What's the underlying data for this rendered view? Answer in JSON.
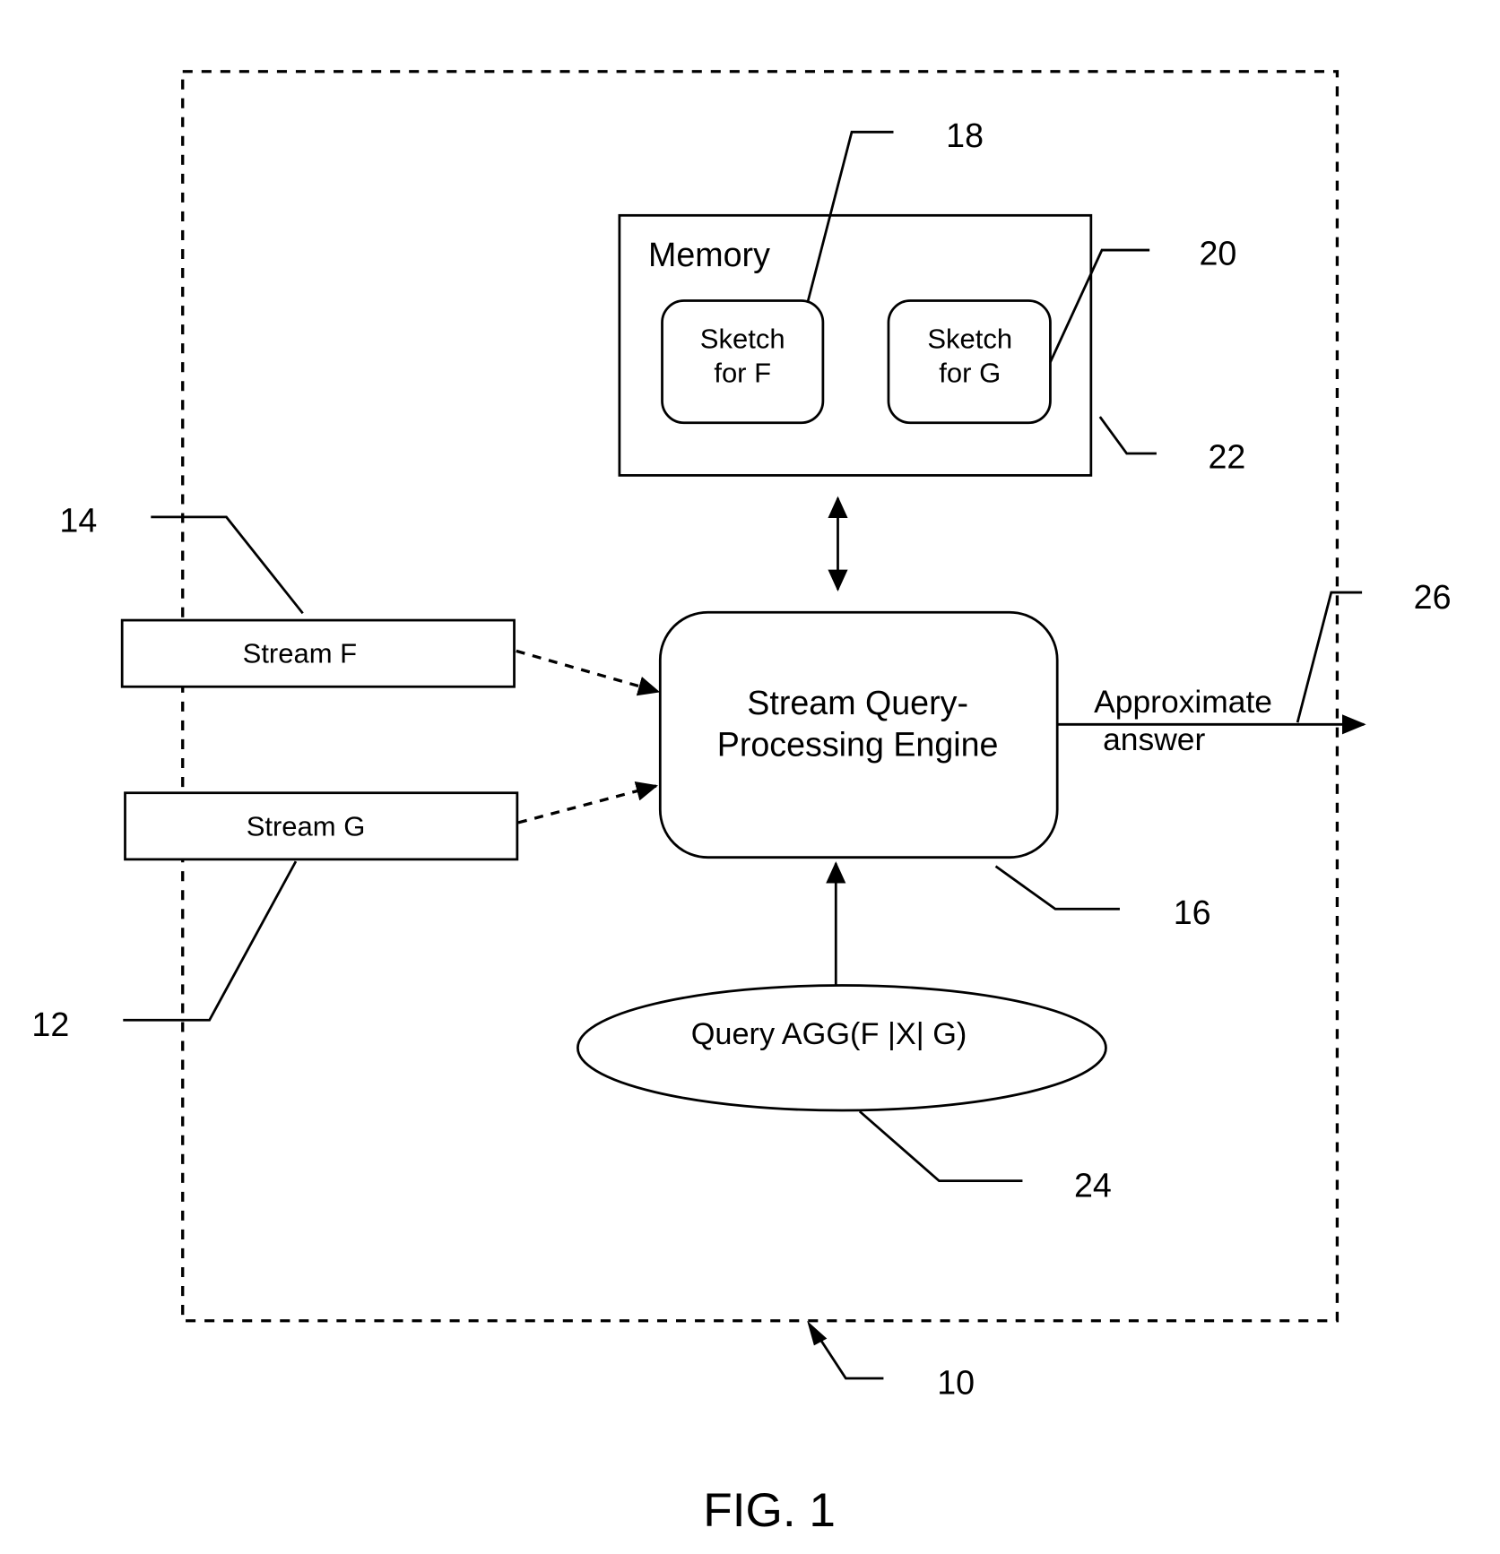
{
  "figure": {
    "caption": "FIG. 1",
    "system_ref": "10"
  },
  "memory": {
    "label": "Memory",
    "ref": "22",
    "sketch_f": {
      "line1": "Sketch",
      "line2": "for F",
      "ref": "18"
    },
    "sketch_g": {
      "line1": "Sketch",
      "line2": "for G",
      "ref": "20"
    }
  },
  "streams": {
    "f": {
      "label": "Stream F",
      "ref": "14"
    },
    "g": {
      "label": "Stream G",
      "ref": "12"
    }
  },
  "engine": {
    "line1": "Stream Query-",
    "line2": "Processing Engine",
    "ref": "16"
  },
  "query": {
    "label": "Query AGG(F |X| G)",
    "ref": "24"
  },
  "output": {
    "line1": "Approximate",
    "line2": "answer",
    "ref": "26"
  }
}
